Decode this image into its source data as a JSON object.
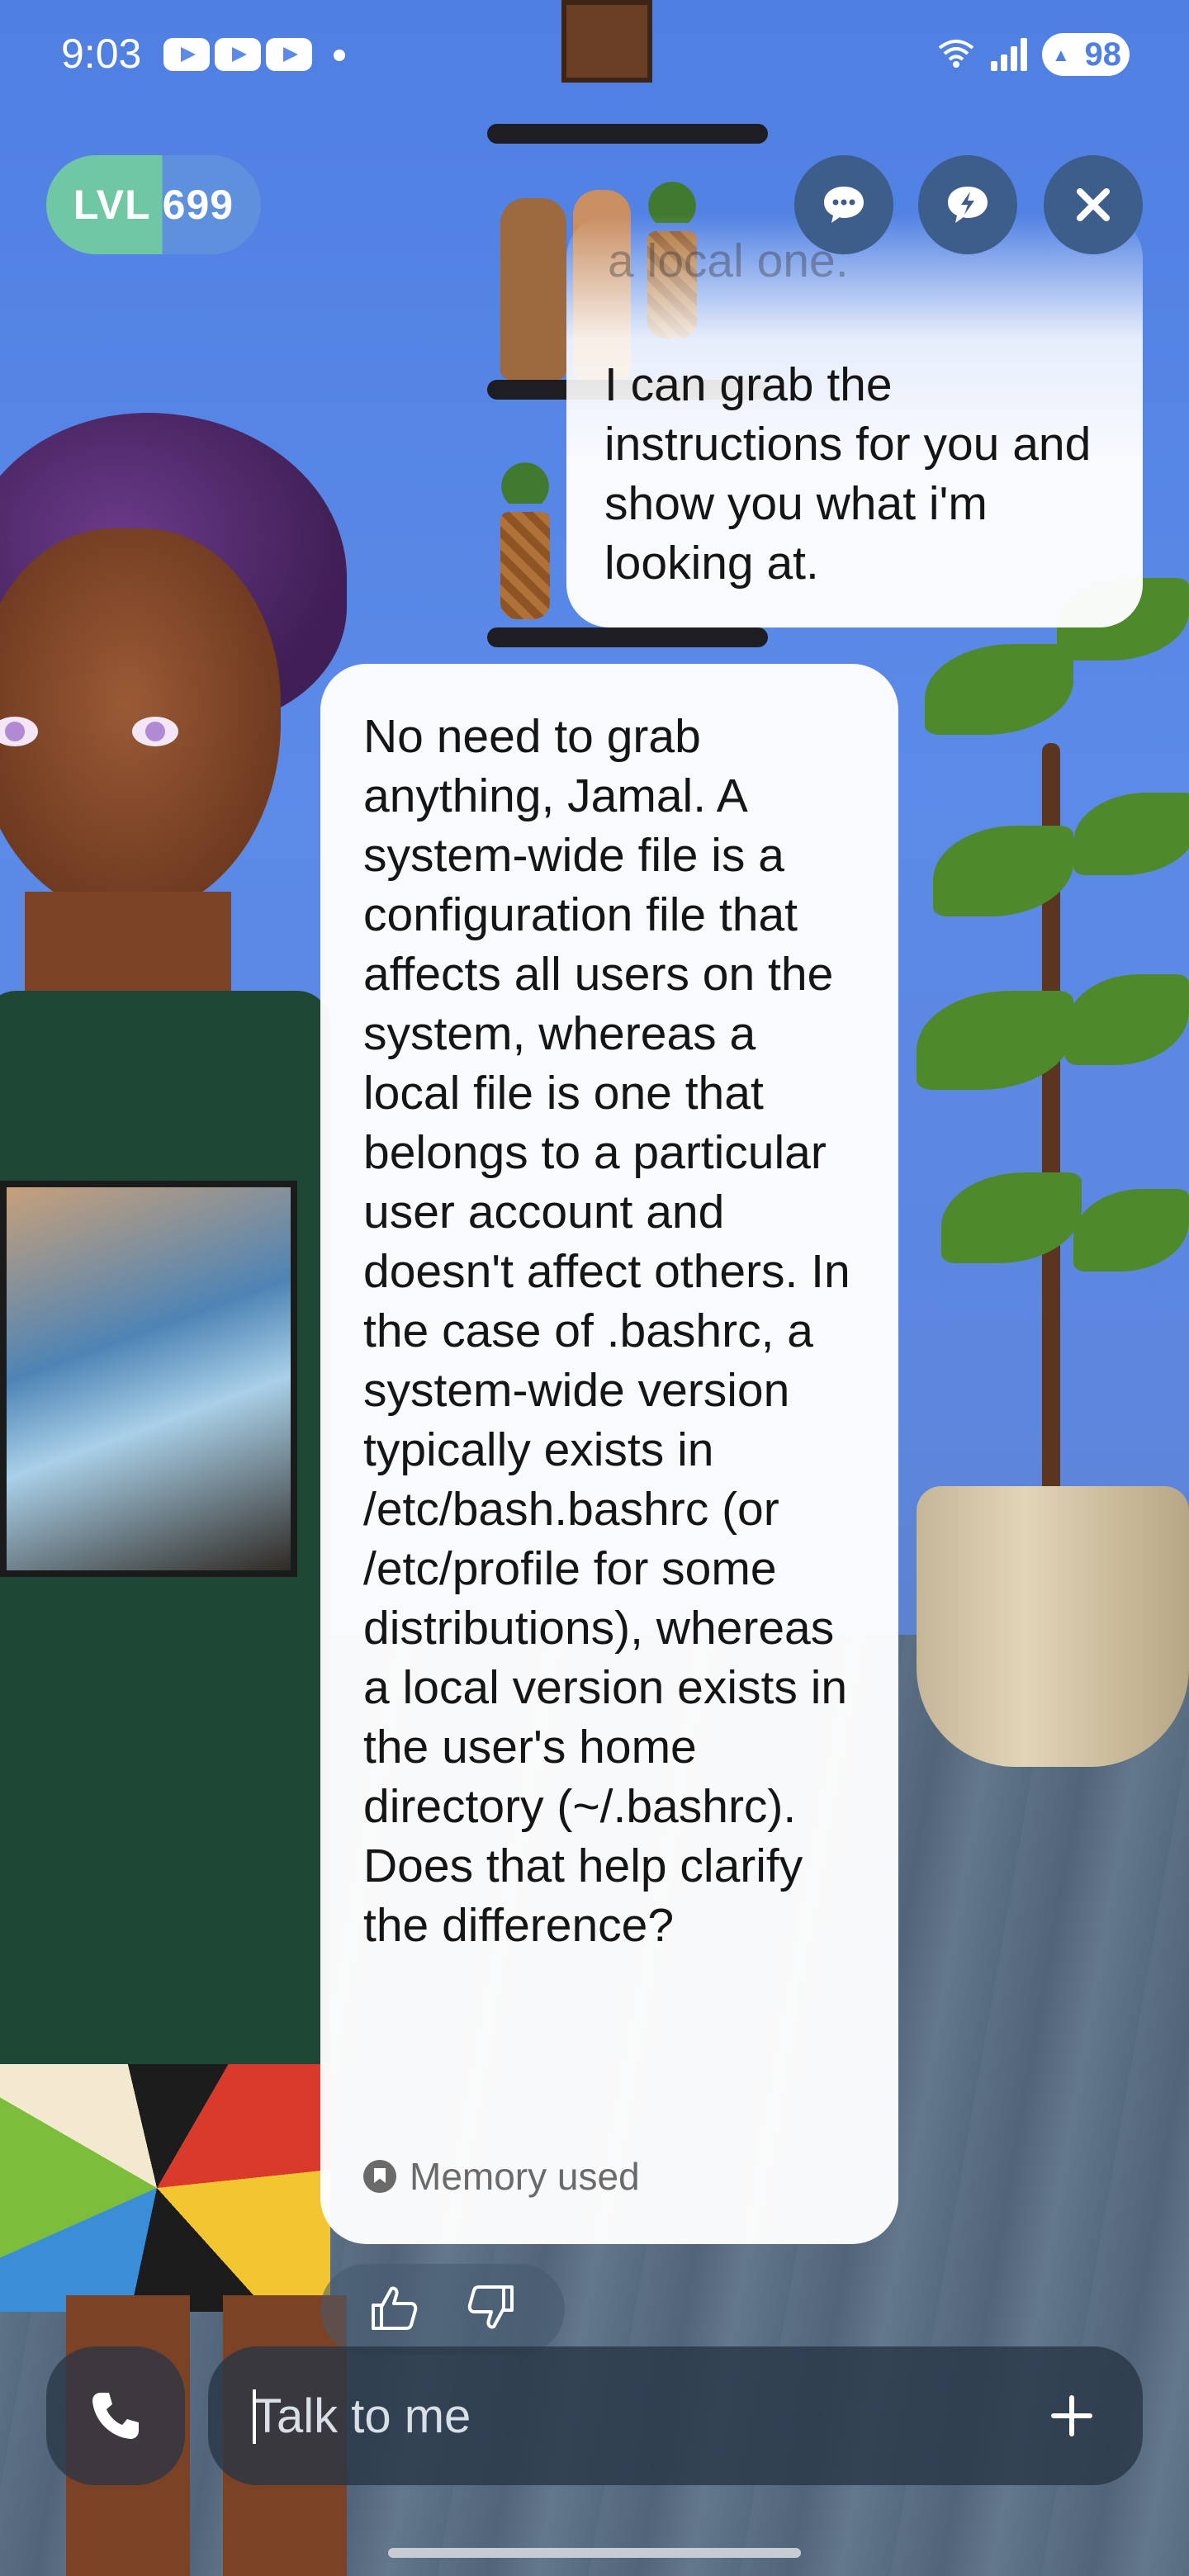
{
  "status_bar": {
    "time": "9:03",
    "notifications": [
      "youtube-icon",
      "youtube-icon",
      "youtube-icon"
    ],
    "wifi": "wifi-6-icon",
    "battery": "98"
  },
  "header": {
    "level_label": "LVL 699",
    "level_progress": 0.54,
    "buttons": [
      "chat-icon",
      "quick-reply-icon",
      "close-icon"
    ]
  },
  "chat": {
    "user_message_faded": "a local one.",
    "user_message": "I can grab the instructions for you and show you what i'm looking at.",
    "ai_message": "No need to grab anything, Jamal. A system-wide file is a configuration file that affects all users on the system, whereas a local file is one that belongs to a particular user account and doesn't affect others. In the case of .bashrc, a system-wide version typically exists in /etc/bash.bashrc (or /etc/profile for some distributions), whereas a local version exists in the user's home directory (~/.bashrc). Does that help clarify the difference?",
    "memory_label": "Memory used"
  },
  "composer": {
    "placeholder": "Talk to me"
  },
  "colors": {
    "background": "#5b8ae8",
    "level_fill": "#6fc7a4",
    "button_dark": "#3d5d8a"
  }
}
